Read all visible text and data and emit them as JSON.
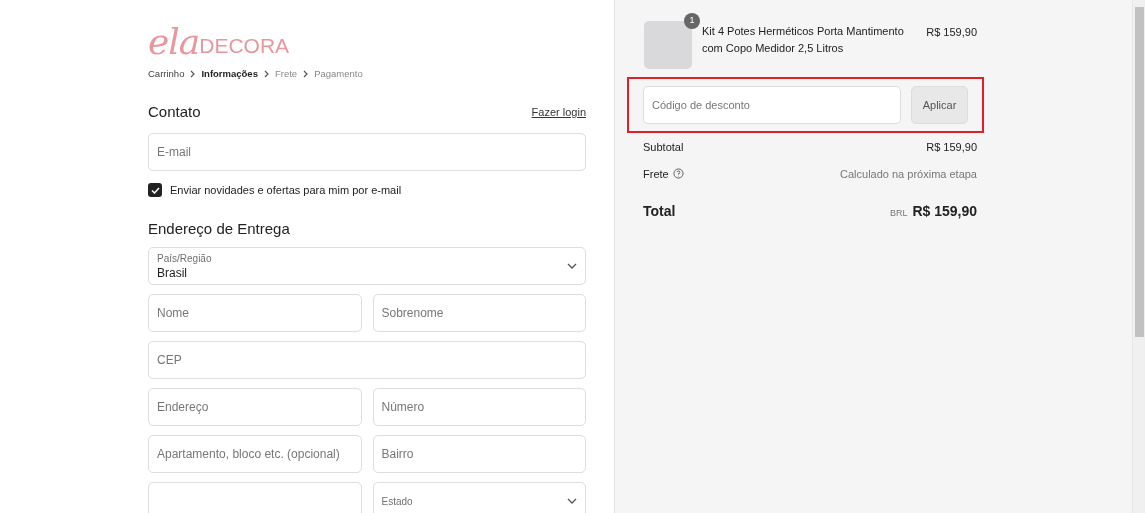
{
  "logo": {
    "script": "ela",
    "caps": "DECORA"
  },
  "breadcrumb": [
    {
      "label": "Carrinho",
      "selected": false
    },
    {
      "label": "Informações",
      "selected": true
    },
    {
      "label": "Frete",
      "selected": false
    },
    {
      "label": "Pagamento",
      "selected": false
    }
  ],
  "contact": {
    "title": "Contato",
    "login_link": "Fazer login",
    "email": {
      "placeholder": "E-mail"
    },
    "newsletter": {
      "label": "Enviar novidades e ofertas para mim por e-mail",
      "checked": true
    }
  },
  "shipping": {
    "title": "Endereço de Entrega",
    "rows": [
      [
        {
          "kind": "select",
          "label": "País/Região",
          "value": "Brasil"
        }
      ],
      [
        {
          "kind": "input",
          "placeholder": "Nome"
        },
        {
          "kind": "input",
          "placeholder": "Sobrenome"
        }
      ],
      [
        {
          "kind": "input",
          "placeholder": "CEP"
        }
      ],
      [
        {
          "kind": "input",
          "placeholder": "Endereço"
        },
        {
          "kind": "input",
          "placeholder": "Número"
        }
      ],
      [
        {
          "kind": "input",
          "placeholder": "Apartamento, bloco etc. (opcional)"
        },
        {
          "kind": "input",
          "placeholder": "Bairro"
        }
      ],
      [
        {
          "kind": "input"
        },
        {
          "kind": "select",
          "label": "Estado"
        }
      ]
    ]
  },
  "summary": {
    "item": {
      "quantity": "1",
      "name": "Kit 4 Potes Herméticos Porta Mantimento com Copo Medidor 2,5 Litros",
      "price": "R$ 159,90"
    },
    "discount": {
      "placeholder": "Código de desconto",
      "button": "Aplicar"
    },
    "subtotal": {
      "label": "Subtotal",
      "value": "R$ 159,90"
    },
    "shipping": {
      "label": "Frete",
      "value": "Calculado na próxima etapa"
    },
    "total": {
      "label": "Total",
      "currency": "BRL",
      "value": "R$ 159,90"
    }
  }
}
